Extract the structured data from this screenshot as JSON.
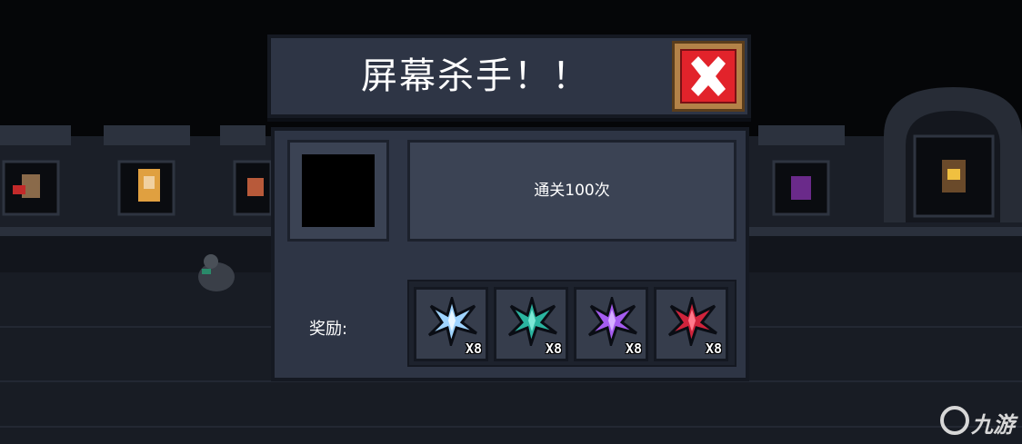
{
  "dialog": {
    "title": "屏幕杀手！！",
    "description": "通关100次",
    "reward_label": "奖励:",
    "close_icon": "close-x-icon"
  },
  "rewards": [
    {
      "icon": "blue-crystal-icon",
      "color": "#9fd4ff",
      "qty": "X8"
    },
    {
      "icon": "teal-crystal-icon",
      "color": "#2bb5a0",
      "qty": "X8"
    },
    {
      "icon": "purple-crystal-icon",
      "color": "#a55cf0",
      "qty": "X8"
    },
    {
      "icon": "red-crystal-icon",
      "color": "#d0243c",
      "qty": "X8"
    }
  ],
  "watermark": {
    "text": "九游"
  }
}
